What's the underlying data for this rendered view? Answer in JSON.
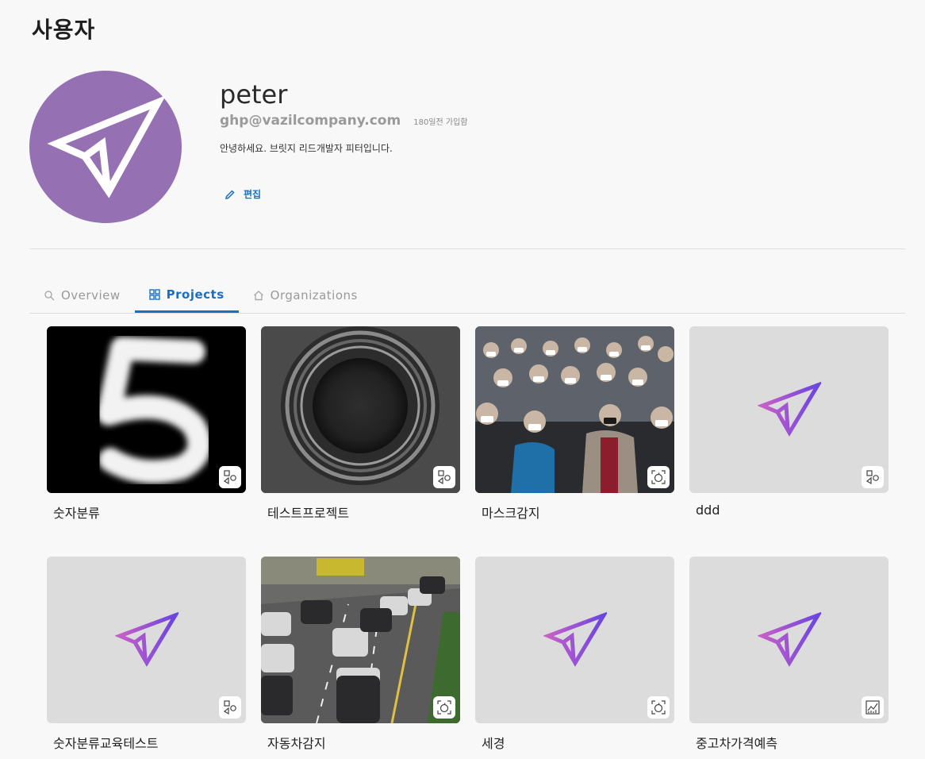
{
  "page": {
    "title": "사용자"
  },
  "profile": {
    "username": "peter",
    "email": "ghp@vazilcompany.com",
    "joined": "180일전 가입함",
    "bio": "안녕하세요. 브릿지 리드개발자 피터입니다.",
    "edit_label": "편집",
    "avatar_color": "#9571b3"
  },
  "tabs": [
    {
      "label": "Overview",
      "icon": "search-icon",
      "active": false
    },
    {
      "label": "Projects",
      "icon": "grid-icon",
      "active": true
    },
    {
      "label": "Organizations",
      "icon": "home-icon",
      "active": false
    }
  ],
  "projects": [
    {
      "title": "숫자분류",
      "thumbnail": "digit-5",
      "badge": "classification-icon"
    },
    {
      "title": "테스트프로젝트",
      "thumbnail": "lens",
      "badge": "classification-icon"
    },
    {
      "title": "마스크감지",
      "thumbnail": "crowd",
      "badge": "detection-icon"
    },
    {
      "title": "ddd",
      "thumbnail": "placeholder-logo",
      "badge": "classification-icon"
    },
    {
      "title": "숫자분류교육테스트",
      "thumbnail": "placeholder-logo",
      "badge": "classification-icon"
    },
    {
      "title": "자동차감지",
      "thumbnail": "traffic",
      "badge": "detection-icon"
    },
    {
      "title": "세경",
      "thumbnail": "placeholder-logo",
      "badge": "detection-icon"
    },
    {
      "title": "중고차가격예측",
      "thumbnail": "placeholder-logo",
      "badge": "chart-icon"
    }
  ],
  "colors": {
    "accent": "#1a6fc4",
    "logo_gradient_start": "#c85fc8",
    "logo_gradient_end": "#6a45e0"
  }
}
